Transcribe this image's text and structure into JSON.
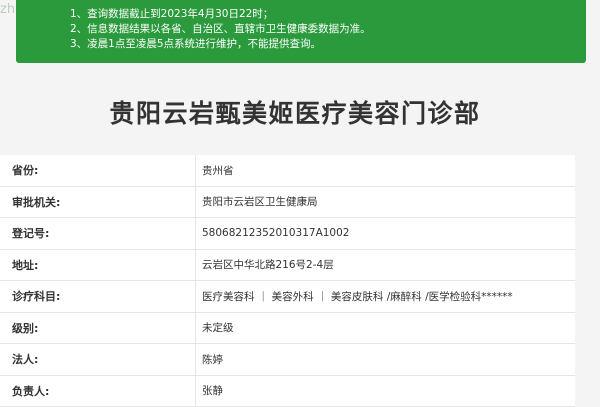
{
  "watermark": "zheng.com",
  "notice": {
    "lines": [
      "1、查询数据截止到2023年4月30日22时；",
      "2、信息数据结果以各省、自治区、直辖市卫生健康委数据为准。",
      "3、凌晨1点至凌晨5点系统进行维护，不能提供查询。"
    ]
  },
  "title": "贵阳云岩甄美姬医疗美容门诊部",
  "rows": [
    {
      "label": "省份:",
      "value": "贵州省"
    },
    {
      "label": "审批机关:",
      "value": "贵阳市云岩区卫生健康局"
    },
    {
      "label": "登记号:",
      "value": "58068212352010317A1002"
    },
    {
      "label": "地址:",
      "value": "云岩区中华北路216号2-4层"
    },
    {
      "label": "诊疗科目:",
      "value": "医疗美容科 ｜ 美容外科 ｜ 美容皮肤科 /麻醉科 /医学检验科******"
    },
    {
      "label": "级别:",
      "value": "未定级"
    },
    {
      "label": "法人:",
      "value": "陈婷"
    },
    {
      "label": "负责人:",
      "value": "张静"
    }
  ]
}
